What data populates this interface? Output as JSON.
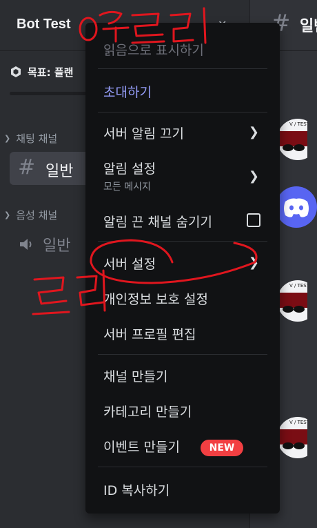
{
  "server": {
    "name": "Bot Test"
  },
  "goal": {
    "label": "목표: 플랜"
  },
  "categories": {
    "text": "채팅 채널",
    "voice": "음성 채널"
  },
  "channels": {
    "text_general": "일반",
    "voice_general": "일반"
  },
  "right_channel": {
    "title": "일반"
  },
  "menu": {
    "mark_read": "읽음으로 표시하기",
    "invite": "초대하기",
    "mute_server": "서버 알림 끄기",
    "notify_settings": "알림 설정",
    "notify_settings_sub": "모든 메시지",
    "hide_muted": "알림 끈 채널 숨기기",
    "server_settings": "서버 설정",
    "privacy_settings": "개인정보 보호 설정",
    "edit_profile": "서버 프로필 편집",
    "create_channel": "채널 만들기",
    "create_category": "카테고리 만들기",
    "create_event": "이벤트 만들기",
    "new_badge": "NEW",
    "copy_id": "ID 복사하기"
  },
  "avatars": {
    "bot_avatar_text": "V / TEST"
  },
  "colors": {
    "accent": "#5865f2",
    "invite": "#949cf7",
    "badge": "#f23f42",
    "annotation": "#e0161e"
  }
}
